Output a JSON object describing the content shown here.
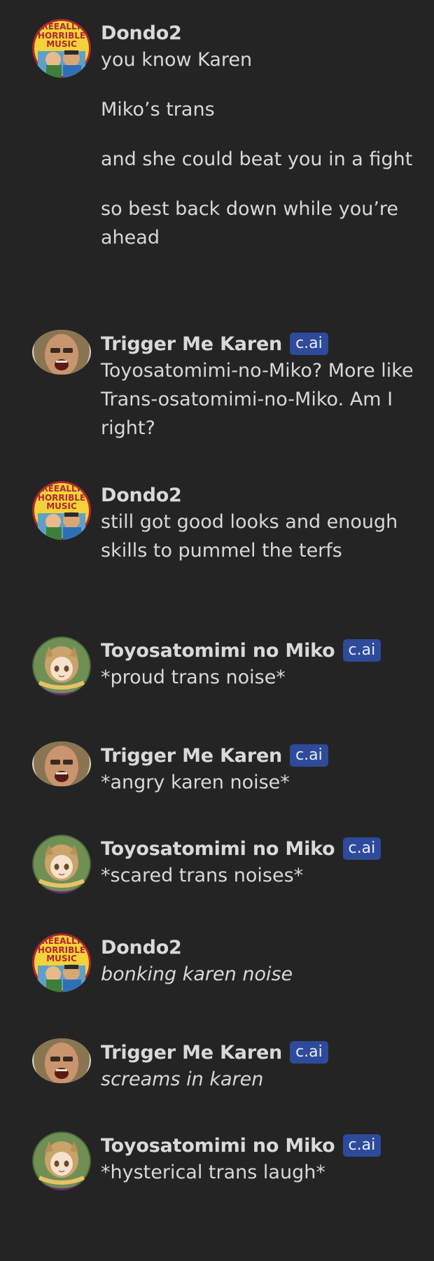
{
  "messages": [
    {
      "author": "Dondo2",
      "avatar": "reallyhorrible-avatar",
      "is_ai": false,
      "badge": "",
      "paragraphs": [
        "you know Karen",
        "Miko’s trans",
        "and she could beat you in a fight",
        "so best back down while you’re ahead"
      ],
      "italic": false
    },
    {
      "author": "Trigger Me Karen",
      "avatar": "karen-avatar",
      "is_ai": true,
      "badge": "c.ai",
      "paragraphs": [
        "Toyosatomimi-no-Miko? More like Trans-osatomimi-no-Miko. Am I right?"
      ],
      "italic": false
    },
    {
      "author": "Dondo2",
      "avatar": "reallyhorrible-avatar",
      "is_ai": false,
      "badge": "",
      "paragraphs": [
        "still got good looks and enough skills to pummel the terfs"
      ],
      "italic": false
    },
    {
      "author": "Toyosatomimi no Miko",
      "avatar": "miko-avatar",
      "is_ai": true,
      "badge": "c.ai",
      "paragraphs": [
        "*proud trans noise*"
      ],
      "italic": false
    },
    {
      "author": "Trigger Me Karen",
      "avatar": "karen-avatar",
      "is_ai": true,
      "badge": "c.ai",
      "paragraphs": [
        "*angry karen noise*"
      ],
      "italic": false
    },
    {
      "author": "Toyosatomimi no Miko",
      "avatar": "miko-avatar",
      "is_ai": true,
      "badge": "c.ai",
      "paragraphs": [
        "*scared trans noises*"
      ],
      "italic": false
    },
    {
      "author": "Dondo2",
      "avatar": "reallyhorrible-avatar",
      "is_ai": false,
      "badge": "",
      "paragraphs": [
        "bonking karen noise"
      ],
      "italic": true
    },
    {
      "author": "Trigger Me Karen",
      "avatar": "karen-avatar",
      "is_ai": true,
      "badge": "c.ai",
      "paragraphs": [
        "screams in karen"
      ],
      "italic": true
    },
    {
      "author": "Toyosatomimi no Miko",
      "avatar": "miko-avatar",
      "is_ai": true,
      "badge": "c.ai",
      "paragraphs": [
        "*hysterical trans laugh*"
      ],
      "italic": false
    }
  ],
  "avatar_art": {
    "reallyhorrible_logo": [
      "REEALLY",
      "HORRIBLE",
      "MUSIC"
    ]
  },
  "colors": {
    "background": "#242424",
    "name_text": "#d9d9d9",
    "body_text": "#d8d8d8",
    "badge_bg": "#2e4a9a",
    "badge_text": "#e8ecf8"
  }
}
